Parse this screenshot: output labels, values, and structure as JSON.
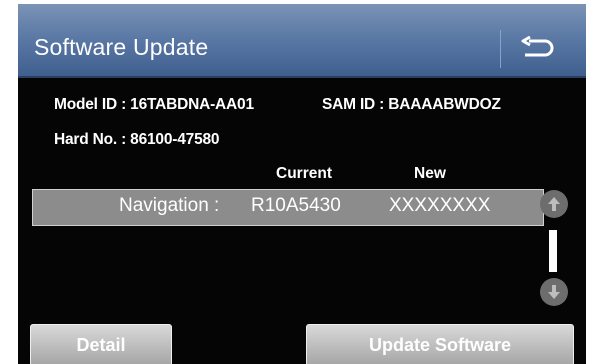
{
  "header": {
    "title": "Software Update",
    "back_icon": "back-arrow-icon"
  },
  "info": {
    "model_id": "Model ID : 16TABDNA-AA01",
    "sam_id": "SAM ID : BAAAABWDOZ",
    "hard_no": "Hard No. : 86100-47580"
  },
  "table": {
    "col_current": "Current",
    "col_new": "New",
    "rows": [
      {
        "label": "Navigation :",
        "current": "R10A5430",
        "new": "XXXXXXXX"
      }
    ]
  },
  "scroll": {
    "up_icon": "scroll-up-icon",
    "down_icon": "scroll-down-icon"
  },
  "buttons": {
    "detail": "Detail",
    "update": "Update Software"
  }
}
